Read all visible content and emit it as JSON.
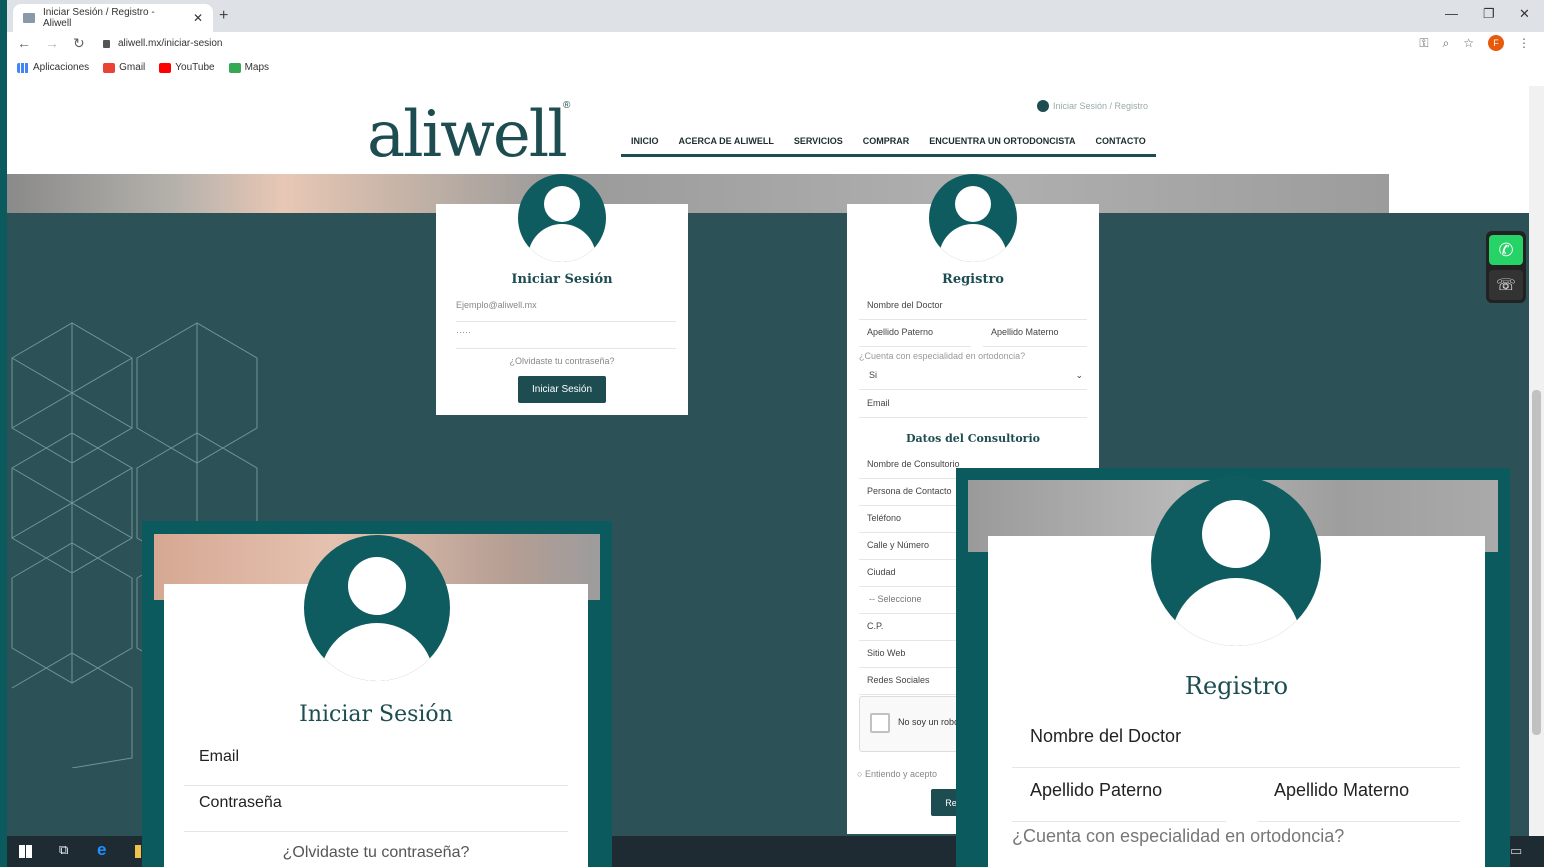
{
  "browser": {
    "tab_title": "Iniciar Sesión / Registro - Aliwell",
    "tab_close": "✕",
    "new_tab": "+",
    "url": "aliwell.mx/iniciar-sesion",
    "profile_initial": "F",
    "bookmarks": [
      "Aplicaciones",
      "Gmail",
      "YouTube",
      "Maps"
    ]
  },
  "site": {
    "logo": "aliwell",
    "logo_mark": "®",
    "login_link": "Iniciar Sesión / Registro",
    "nav": [
      "INICIO",
      "ACERCA DE ALIWELL",
      "SERVICIOS",
      "COMPRAR",
      "ENCUENTRA UN ORTODONCISTA",
      "CONTACTO"
    ]
  },
  "login_card": {
    "title": "Iniciar Sesión",
    "email_placeholder": "Ejemplo@aliwell.mx",
    "password_mask": "·····",
    "forgot": "¿Olvidaste tu contraseña?",
    "submit": "Iniciar Sesión"
  },
  "register_card": {
    "title": "Registro",
    "doctor_name": "Nombre del Doctor",
    "apellido_paterno": "Apellido Paterno",
    "apellido_materno": "Apellido Materno",
    "especialidad_q": "¿Cuenta con especialidad en ortodoncia?",
    "especialidad_value": "Si",
    "email": "Email",
    "section_consultorio": "Datos del Consultorio",
    "consultorio_fields": [
      "Nombre de Consultorio",
      "Persona de Contacto",
      "Teléfono",
      "Calle y Número",
      "Ciudad",
      "-- Seleccione",
      "C.P.",
      "Sitio Web",
      "Redes Sociales"
    ],
    "captcha": "No soy un robot",
    "terms": "Entiendo y acepto",
    "submit_partial": "Re"
  },
  "zoom_login": {
    "title": "Iniciar Sesión",
    "email": "Email",
    "password": "Contraseña",
    "forgot": "¿Olvidaste tu contraseña?"
  },
  "zoom_register": {
    "title": "Registro",
    "doctor_name": "Nombre del Doctor",
    "apellido_paterno": "Apellido Paterno",
    "apellido_materno": "Apellido Materno",
    "especialidad_q": "¿Cuenta con especialidad en ortodoncia?"
  },
  "colors": {
    "brand_teal": "#1d4d50",
    "frame_teal": "#0b5b5e",
    "page_bg": "#2c5257",
    "whatsapp": "#25d366"
  }
}
